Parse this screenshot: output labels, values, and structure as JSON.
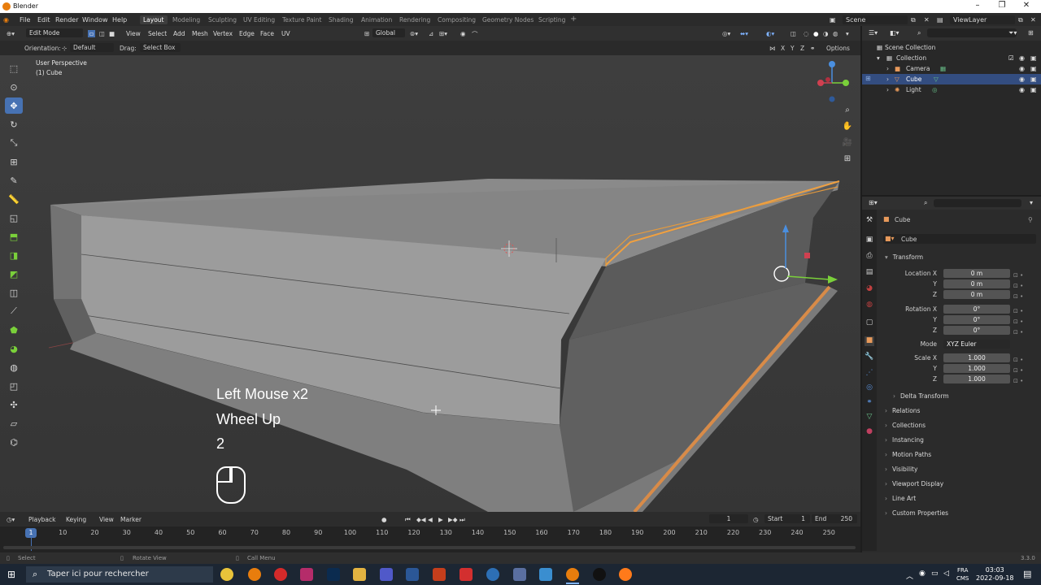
{
  "window": {
    "title": "Blender"
  },
  "menu": [
    "File",
    "Edit",
    "Render",
    "Window",
    "Help"
  ],
  "workspaces": [
    "Layout",
    "Modeling",
    "Sculpting",
    "UV Editing",
    "Texture Paint",
    "Shading",
    "Animation",
    "Rendering",
    "Compositing",
    "Geometry Nodes",
    "Scripting",
    "+"
  ],
  "scene": {
    "name": "Scene",
    "view_layer": "ViewLayer"
  },
  "viewport_header": {
    "mode": "Edit Mode",
    "menus": [
      "View",
      "Select",
      "Add",
      "Mesh",
      "Vertex",
      "Edge",
      "Face",
      "UV"
    ],
    "transform_orientation": "Global"
  },
  "tool_settings": {
    "orientation_label": "Orientation:",
    "orientation_value": "Default",
    "drag_label": "Drag:",
    "drag_value": "Select Box",
    "options": "Options",
    "axes": [
      "X",
      "Y",
      "Z"
    ]
  },
  "viewport": {
    "view_name": "User Perspective",
    "object_name": "(1) Cube",
    "screencast": [
      "Left Mouse x2",
      "Wheel Up",
      "2"
    ]
  },
  "outliner": {
    "root": "Scene Collection",
    "collection": "Collection",
    "items": [
      "Camera",
      "Cube",
      "Light"
    ],
    "selected": "Cube"
  },
  "properties": {
    "object_name": "Cube",
    "datablock": "Cube",
    "transform_title": "Transform",
    "location": {
      "label": "Location X",
      "x": "0 m",
      "y": "0 m",
      "z": "0 m"
    },
    "rotation": {
      "label": "Rotation X",
      "x": "0°",
      "y": "0°",
      "z": "0°"
    },
    "mode_label": "Mode",
    "mode_value": "XYZ Euler",
    "scale": {
      "label": "Scale X",
      "x": "1.000",
      "y": "1.000",
      "z": "1.000"
    },
    "axis_y": "Y",
    "axis_z": "Z",
    "delta_transform": "Delta Transform",
    "sections": [
      "Relations",
      "Collections",
      "Instancing",
      "Motion Paths",
      "Visibility",
      "Viewport Display",
      "Line Art",
      "Custom Properties"
    ]
  },
  "timeline": {
    "menus": [
      "Playback",
      "Keying",
      "View",
      "Marker"
    ],
    "current_frame": "1",
    "start_label": "Start",
    "start": "1",
    "end_label": "End",
    "end": "250",
    "ticks": [
      "10",
      "20",
      "30",
      "40",
      "50",
      "60",
      "70",
      "80",
      "90",
      "100",
      "110",
      "120",
      "130",
      "140",
      "150",
      "160",
      "170",
      "180",
      "190",
      "200",
      "210",
      "220",
      "230",
      "240",
      "250"
    ],
    "playhead": "1"
  },
  "statusbar": {
    "select": "Select",
    "rotate": "Rotate View",
    "call_menu": "Call Menu",
    "version": "3.3.0"
  },
  "taskbar": {
    "search_placeholder": "Taper ici pour rechercher",
    "lang_1": "FRA",
    "lang_2": "CMS",
    "time": "03:03",
    "date": "2022-09-18"
  },
  "colors": {
    "accent": "#4772b3",
    "selection_orange": "#f0a040",
    "brand": "#e87d0d"
  }
}
